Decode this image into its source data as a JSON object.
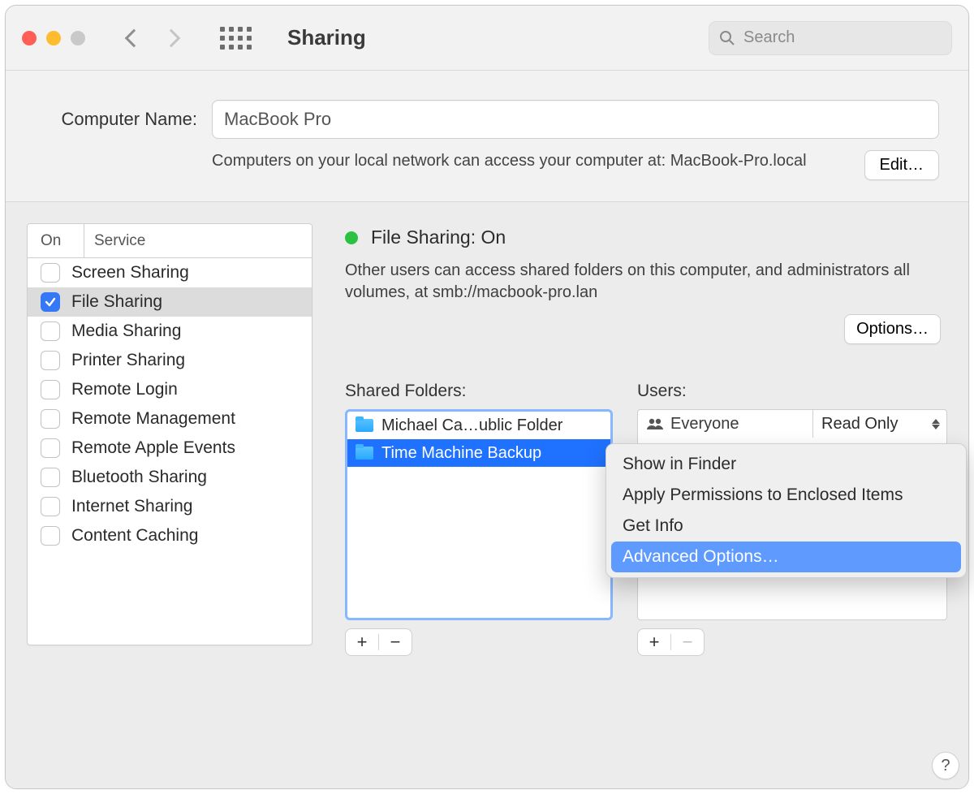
{
  "window": {
    "title": "Sharing"
  },
  "search": {
    "placeholder": "Search"
  },
  "computerName": {
    "label": "Computer Name:",
    "value": "MacBook Pro",
    "description": "Computers on your local network can access your computer at: MacBook-Pro.local",
    "editButton": "Edit…"
  },
  "servicesHeader": {
    "on": "On",
    "service": "Service"
  },
  "services": [
    {
      "label": "Screen Sharing",
      "on": false,
      "selected": false
    },
    {
      "label": "File Sharing",
      "on": true,
      "selected": true
    },
    {
      "label": "Media Sharing",
      "on": false,
      "selected": false
    },
    {
      "label": "Printer Sharing",
      "on": false,
      "selected": false
    },
    {
      "label": "Remote Login",
      "on": false,
      "selected": false
    },
    {
      "label": "Remote Management",
      "on": false,
      "selected": false
    },
    {
      "label": "Remote Apple Events",
      "on": false,
      "selected": false
    },
    {
      "label": "Bluetooth Sharing",
      "on": false,
      "selected": false
    },
    {
      "label": "Internet Sharing",
      "on": false,
      "selected": false
    },
    {
      "label": "Content Caching",
      "on": false,
      "selected": false
    }
  ],
  "status": {
    "title": "File Sharing: On",
    "description": "Other users can access shared folders on this computer, and administrators all volumes, at smb://macbook-pro.lan"
  },
  "optionsButton": "Options…",
  "sharedFolders": {
    "label": "Shared Folders:",
    "items": [
      {
        "label": "Michael Ca…ublic Folder",
        "selected": false
      },
      {
        "label": "Time Machine Backup",
        "selected": true
      }
    ]
  },
  "users": {
    "label": "Users:",
    "items": [
      {
        "name": "Everyone",
        "permission": "Read Only"
      }
    ]
  },
  "contextMenu": {
    "items": [
      {
        "label": "Show in Finder",
        "highlighted": false
      },
      {
        "label": "Apply Permissions to Enclosed Items",
        "highlighted": false
      },
      {
        "label": "Get Info",
        "highlighted": false
      },
      {
        "label": "Advanced Options…",
        "highlighted": true
      }
    ]
  },
  "buttons": {
    "add": "+",
    "remove": "−",
    "help": "?"
  }
}
